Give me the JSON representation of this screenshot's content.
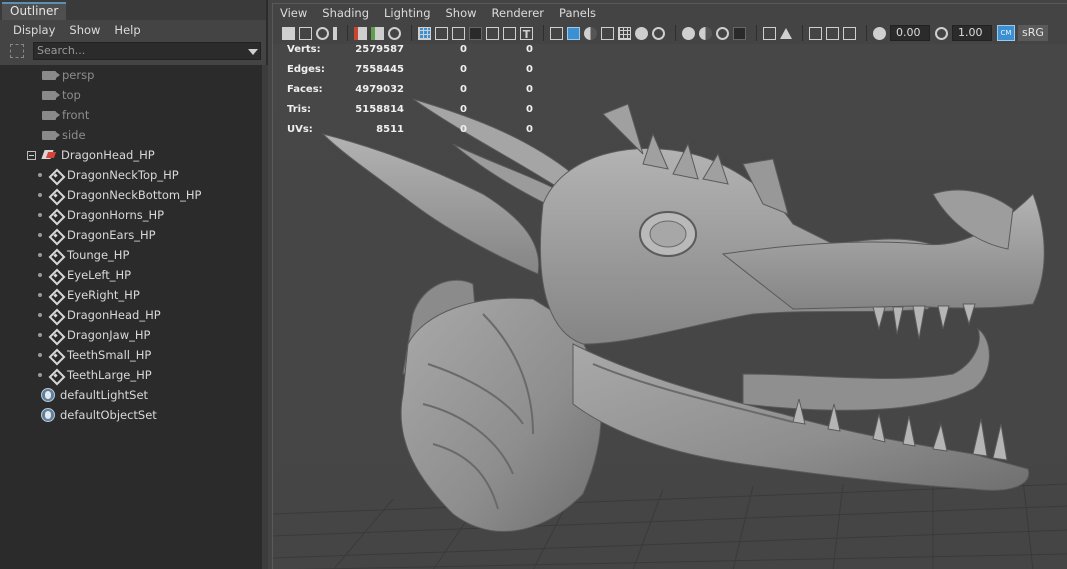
{
  "outliner": {
    "tab_title": "Outliner",
    "menus": [
      "Display",
      "Show",
      "Help"
    ],
    "search_placeholder": "Search...",
    "cameras": [
      "persp",
      "top",
      "front",
      "side"
    ],
    "group": "DragonHead_HP",
    "children": [
      "DragonNeckTop_HP",
      "DragonNeckBottom_HP",
      "DragonHorns_HP",
      "DragonEars_HP",
      "Tounge_HP",
      "EyeLeft_HP",
      "EyeRight_HP",
      "DragonHead_HP",
      "DragonJaw_HP",
      "TeethSmall_HP",
      "TeethLarge_HP"
    ],
    "sets": [
      "defaultLightSet",
      "defaultObjectSet"
    ]
  },
  "viewport": {
    "menus": [
      "View",
      "Shading",
      "Lighting",
      "Show",
      "Renderer",
      "Panels"
    ],
    "exposure": "0.00",
    "gamma": "1.00",
    "color_mgmt_badge": "CM",
    "color_space": "sRG",
    "accent_color": "#3c8fd1",
    "hud": [
      {
        "label": "Verts:",
        "v1": "2579587",
        "v2": "0",
        "v3": "0"
      },
      {
        "label": "Edges:",
        "v1": "7558445",
        "v2": "0",
        "v3": "0"
      },
      {
        "label": "Faces:",
        "v1": "4979032",
        "v2": "0",
        "v3": "0"
      },
      {
        "label": "Tris:",
        "v1": "5158814",
        "v2": "0",
        "v3": "0"
      },
      {
        "label": "UVs:",
        "v1": "8511",
        "v2": "0",
        "v3": "0"
      }
    ]
  }
}
